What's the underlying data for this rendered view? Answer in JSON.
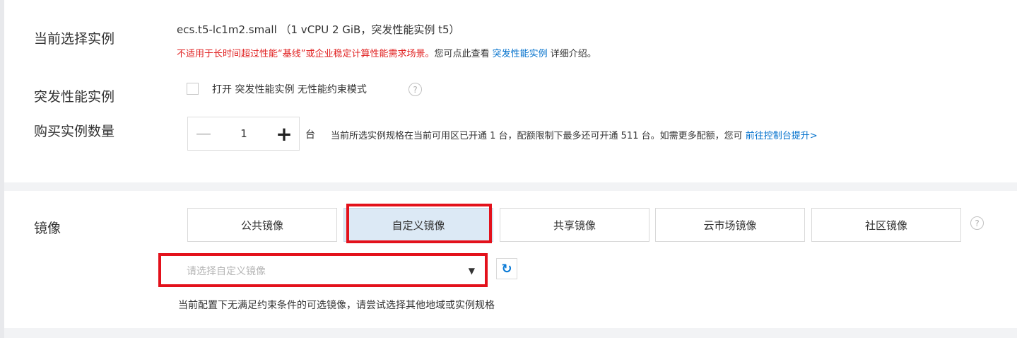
{
  "instance": {
    "label": "当前选择实例",
    "spec": "ecs.t5-lc1m2.small （1 vCPU 2 GiB，突发性能实例 t5）",
    "warning_red": "不适用于长时间超过性能“基线”或企业稳定计算性能需求场景。",
    "warning_text": "您可点此查看 ",
    "warning_link": "突发性能实例",
    "warning_suffix": " 详细介绍。"
  },
  "burst": {
    "label": "突发性能实例",
    "checkbox_label": "打开 突发性能实例 无性能约束模式",
    "checked": false,
    "help_icon": "question-circle-icon"
  },
  "quantity": {
    "label": "购买实例数量",
    "minus": "—",
    "value": "1",
    "plus": "+",
    "unit": "台",
    "quota_text": "当前所选实例规格在当前可用区已开通 1 台，配额限制下最多还可开通 511 台。如需更多配额，您可 ",
    "quota_link": "前往控制台提升>"
  },
  "image": {
    "label": "镜像",
    "tabs": [
      {
        "label": "公共镜像",
        "active": false
      },
      {
        "label": "自定义镜像",
        "active": true
      },
      {
        "label": "共享镜像",
        "active": false
      },
      {
        "label": "云市场镜像",
        "active": false
      },
      {
        "label": "社区镜像",
        "active": false
      }
    ],
    "help_icon": "question-circle-icon",
    "select_placeholder": "请选择自定义镜像",
    "select_caret": "▼",
    "refresh_icon": "refresh-icon",
    "hint": "当前配置下无满足约束条件的可选镜像，请尝试选择其他地域或实例规格"
  },
  "colors": {
    "accent": "#0070cc",
    "warning": "#e02020",
    "highlight_box": "#e3111b",
    "active_tab": "#dce9f5"
  }
}
